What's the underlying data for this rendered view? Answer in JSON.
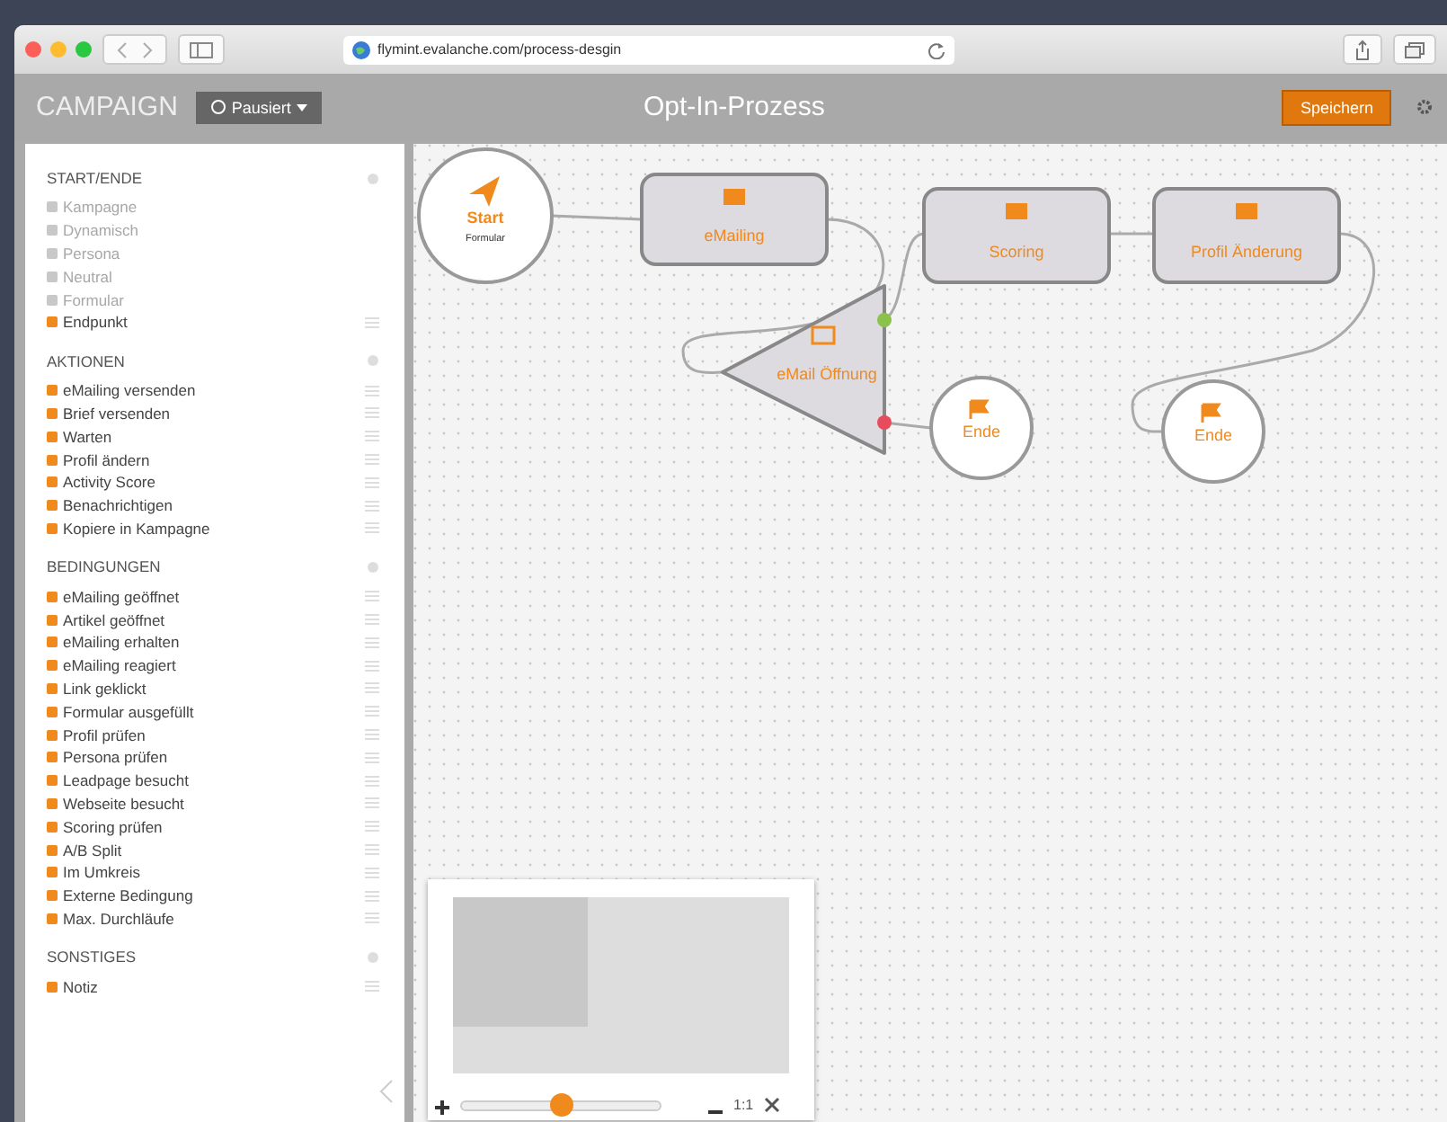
{
  "browser": {
    "url": "flymint.evalanche.com/process-desgin"
  },
  "header": {
    "brand": "CAMPAIGN",
    "status": "Pausiert",
    "title": "Opt-In-Prozess",
    "save": "Speichern"
  },
  "sidebar": {
    "sections": [
      {
        "title": "START/ENDE",
        "items": [
          {
            "label": "Kampagne",
            "disabled": true,
            "draggable": false
          },
          {
            "label": "Dynamisch",
            "disabled": true,
            "draggable": false
          },
          {
            "label": "Persona",
            "disabled": true,
            "draggable": false
          },
          {
            "label": "Neutral",
            "disabled": true,
            "draggable": false
          },
          {
            "label": "Formular",
            "disabled": true,
            "draggable": false
          },
          {
            "label": "Endpunkt",
            "disabled": false,
            "draggable": true
          }
        ]
      },
      {
        "title": "AKTIONEN",
        "items": [
          {
            "label": "eMailing versenden",
            "disabled": false,
            "draggable": true
          },
          {
            "label": "Brief versenden",
            "disabled": false,
            "draggable": true
          },
          {
            "label": "Warten",
            "disabled": false,
            "draggable": true
          },
          {
            "label": "Profil ändern",
            "disabled": false,
            "draggable": true
          },
          {
            "label": "Activity Score",
            "disabled": false,
            "draggable": true
          },
          {
            "label": "Benachrichtigen",
            "disabled": false,
            "draggable": true
          },
          {
            "label": "Kopiere in Kampagne",
            "disabled": false,
            "draggable": true
          }
        ]
      },
      {
        "title": "BEDINGUNGEN",
        "items": [
          {
            "label": "eMailing geöffnet",
            "disabled": false,
            "draggable": true
          },
          {
            "label": "Artikel geöffnet",
            "disabled": false,
            "draggable": true
          },
          {
            "label": "eMailing erhalten",
            "disabled": false,
            "draggable": true
          },
          {
            "label": "eMailing reagiert",
            "disabled": false,
            "draggable": true
          },
          {
            "label": "Link geklickt",
            "disabled": false,
            "draggable": true
          },
          {
            "label": "Formular ausgefüllt",
            "disabled": false,
            "draggable": true
          },
          {
            "label": "Profil prüfen",
            "disabled": false,
            "draggable": true
          },
          {
            "label": "Persona prüfen",
            "disabled": false,
            "draggable": true
          },
          {
            "label": "Leadpage besucht",
            "disabled": false,
            "draggable": true
          },
          {
            "label": "Webseite besucht",
            "disabled": false,
            "draggable": true
          },
          {
            "label": "Scoring prüfen",
            "disabled": false,
            "draggable": true
          },
          {
            "label": "A/B Split",
            "disabled": false,
            "draggable": true
          },
          {
            "label": "Im Umkreis",
            "disabled": false,
            "draggable": true
          },
          {
            "label": "Externe Bedingung",
            "disabled": false,
            "draggable": true
          },
          {
            "label": "Max. Durchläufe",
            "disabled": false,
            "draggable": true
          }
        ]
      },
      {
        "title": "SONSTIGES",
        "items": [
          {
            "label": "Notiz",
            "disabled": false,
            "draggable": true
          }
        ]
      }
    ]
  },
  "canvas": {
    "nodes": [
      {
        "kind": "start",
        "label": "Start",
        "sublabel": "Formular"
      },
      {
        "kind": "action",
        "label": "eMailing"
      },
      {
        "kind": "condition",
        "label": "eMail Öffnung"
      },
      {
        "kind": "end",
        "label": "Ende"
      },
      {
        "kind": "action",
        "label": "Scoring"
      },
      {
        "kind": "action",
        "label": "Profil Änderung"
      },
      {
        "kind": "end",
        "label": "Ende"
      }
    ]
  },
  "minimap": {
    "zoom_label": "1:1",
    "level": 0.5
  }
}
